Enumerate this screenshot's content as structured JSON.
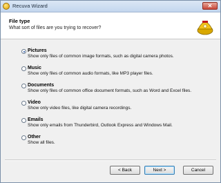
{
  "window": {
    "title": "Recuva Wizard",
    "close_glyph": "✕"
  },
  "header": {
    "title": "File type",
    "subtitle": "What sort of files are you trying to recover?"
  },
  "options": [
    {
      "label": "Pictures",
      "desc": "Show only files of common image formats, such as digital camera photos.",
      "checked": true
    },
    {
      "label": "Music",
      "desc": "Show only files of common audio formats, like MP3 player files.",
      "checked": false
    },
    {
      "label": "Documents",
      "desc": "Show only files of common office document formats, such as Word and Excel files.",
      "checked": false
    },
    {
      "label": "Video",
      "desc": "Show only video files, like digital camera recordings.",
      "checked": false
    },
    {
      "label": "Emails",
      "desc": "Show only emails from Thunderbird, Outlook Express and Windows Mail.",
      "checked": false
    },
    {
      "label": "Other",
      "desc": "Show all files.",
      "checked": false
    }
  ],
  "buttons": {
    "back": "< Back",
    "next": "Next >",
    "cancel": "Cancel"
  },
  "colors": {
    "accent": "#1d4fa0",
    "logo_yellow": "#f2c21a"
  }
}
